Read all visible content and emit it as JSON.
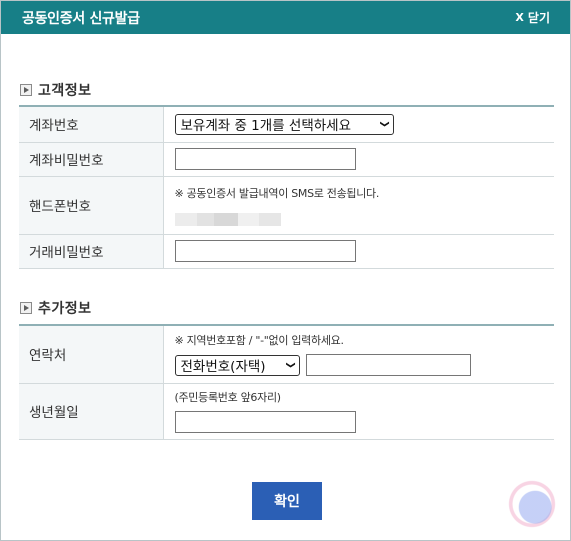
{
  "window": {
    "title": "공동인증서 신규발급",
    "close_label": "닫기",
    "close_glyph": "X"
  },
  "sections": {
    "customer_info": "고객정보",
    "extra_info": "추가정보"
  },
  "customer": {
    "account_label": "계좌번호",
    "account_selected": "보유계좌 중 1개를 선택하세요",
    "account_password_label": "계좌비밀번호",
    "phone_label": "핸드폰번호",
    "phone_note": "※ 공동인증서 발급내역이 SMS로 전송됩니다.",
    "trade_password_label": "거래비밀번호"
  },
  "extra": {
    "contact_label": "연락처",
    "contact_note": "※ 지역번호포함 / \"-\"없이 입력하세요.",
    "phone_type_selected": "전화번호(자택)",
    "birth_label": "생년월일",
    "birth_note": "(주민등록번호 앞6자리)"
  },
  "buttons": {
    "confirm": "확인"
  },
  "colors": {
    "titlebar": "#177f87",
    "confirm_button": "#2b5fb5",
    "header_cell": "#f4f7f8"
  }
}
